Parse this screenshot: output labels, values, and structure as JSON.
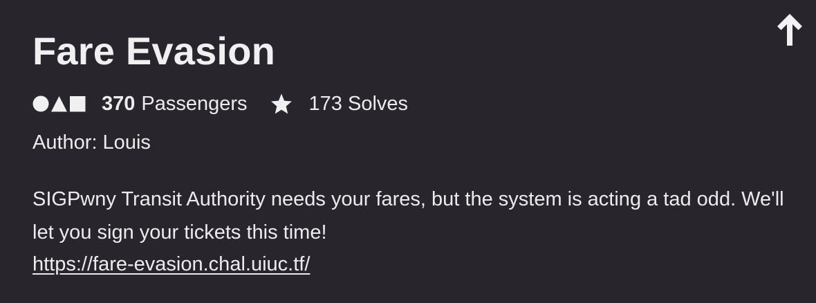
{
  "challenge": {
    "title": "Fare Evasion",
    "passengers_count": "370",
    "passengers_label": "Passengers",
    "solves_label": "173 Solves",
    "author": "Author: Louis",
    "description": "SIGPwny Transit Authority needs your fares, but the system is acting a tad odd. We'll let you sign your tickets this time!",
    "link": "https://fare-evasion.chal.uiuc.tf/"
  },
  "icons": {
    "collapse": "arrow-up-icon",
    "category": "shapes-icon",
    "solves": "star-icon"
  },
  "colors": {
    "background": "#28262c",
    "text": "#ececec"
  }
}
